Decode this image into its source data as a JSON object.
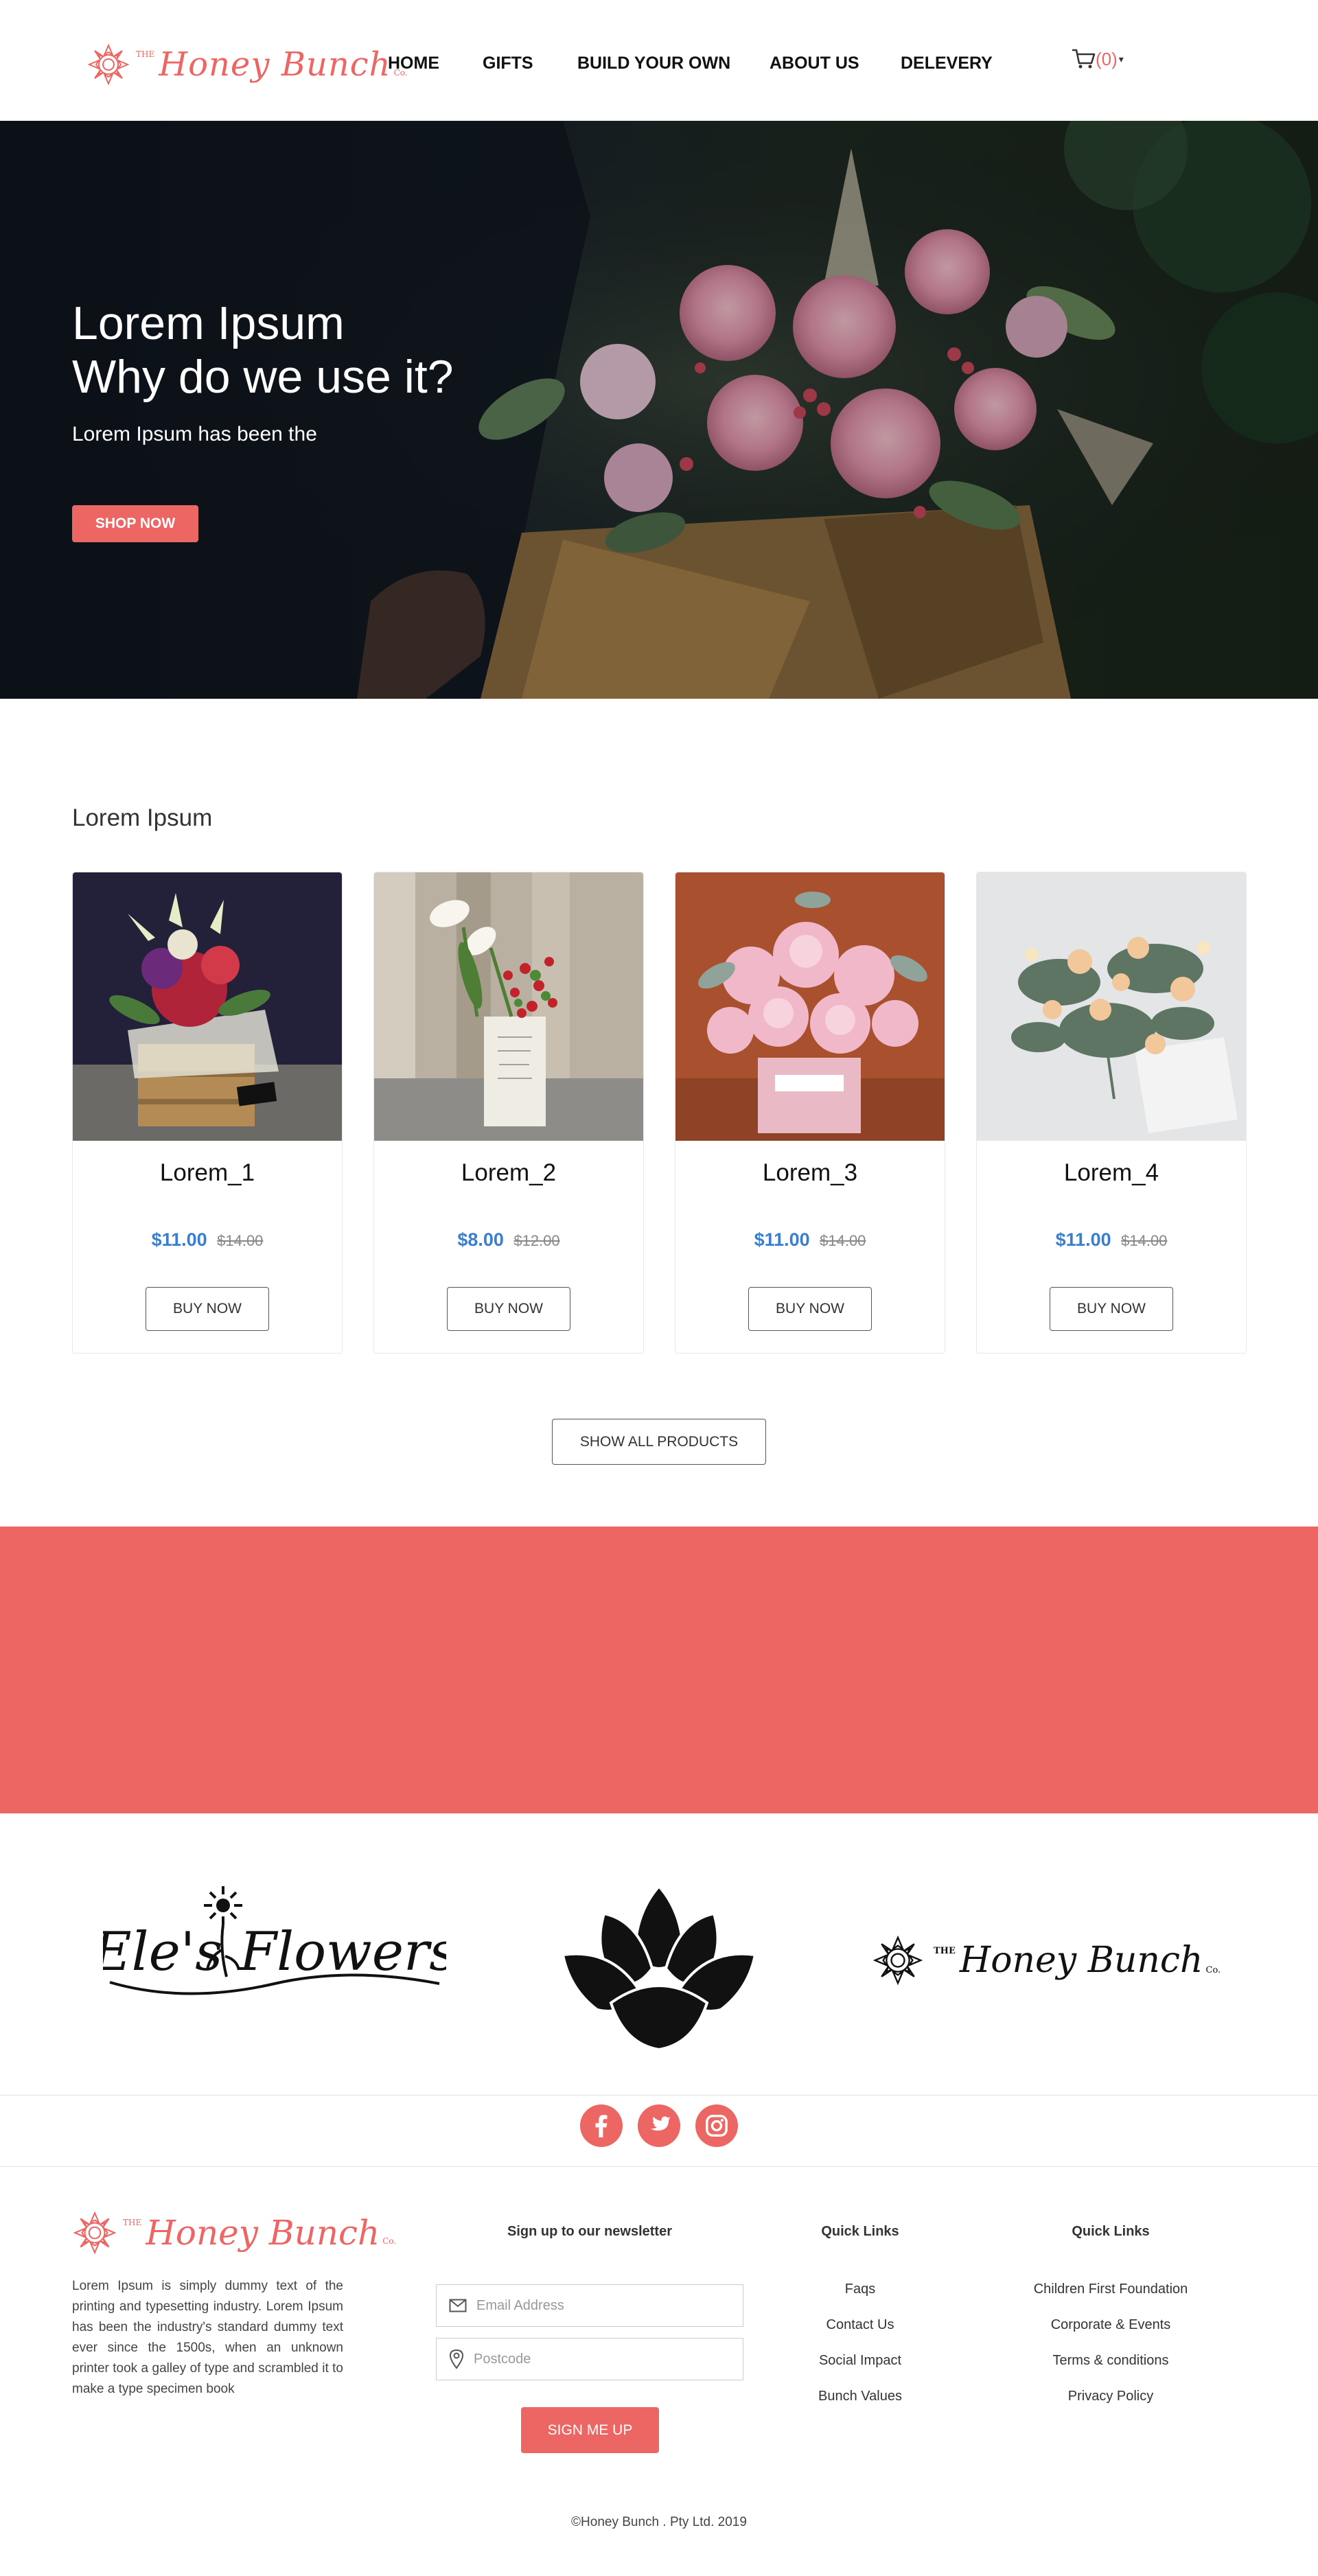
{
  "brand": {
    "logo_prefix": "THE",
    "logo_name": "Honey Bunch",
    "logo_suffix": "Co.",
    "accent_color": "#ec6664",
    "price_color": "#3a7fcf"
  },
  "nav": {
    "items": [
      "HOME",
      "GIFTS",
      "BUILD YOUR OWN",
      "ABOUT US",
      "DELEVERY"
    ]
  },
  "cart": {
    "icon": "cart-icon",
    "count_label": "(0)"
  },
  "hero": {
    "title_line1": "Lorem Ipsum",
    "title_line2": "Why do we use it?",
    "subtitle": "Lorem Ipsum has been the",
    "button_label": "SHOP NOW"
  },
  "products": {
    "section_title": "Lorem Ipsum",
    "items": [
      {
        "name": "Lorem_1",
        "price": "$11.00",
        "old_price": "$14.00",
        "button": "BUY NOW"
      },
      {
        "name": "Lorem_2",
        "price": "$8.00",
        "old_price": "$12.00",
        "button": "BUY NOW"
      },
      {
        "name": "Lorem_3",
        "price": "$11.00",
        "old_price": "$14.00",
        "button": "BUY NOW"
      },
      {
        "name": "Lorem_4",
        "price": "$11.00",
        "old_price": "$14.00",
        "button": "BUY NOW"
      }
    ],
    "show_all_label": "SHOW ALL PRODUCTS"
  },
  "partners": {
    "eles_flowers": "Ele's Flowers",
    "honey_bunch_prefix": "THE",
    "honey_bunch_name": "Honey Bunch",
    "honey_bunch_suffix": "Co."
  },
  "social": [
    "facebook-icon",
    "twitter-icon",
    "instagram-icon"
  ],
  "footer": {
    "about": "Lorem Ipsum is simply dummy text of the printing and typesetting industry. Lorem Ipsum has been the industry's standard dummy text ever since the 1500s, when an unknown printer took a galley of type and scrambled it to make a type specimen book",
    "newsletter_heading": "Sign up to our newsletter",
    "email_placeholder": "Email Address",
    "postcode_placeholder": "Postcode",
    "signup_label": "SIGN ME UP",
    "quick_links_1": {
      "heading": "Quick Links",
      "links": [
        "Faqs",
        "Contact Us",
        "Social Impact",
        "Bunch Values"
      ]
    },
    "quick_links_2": {
      "heading": "Quick Links",
      "links": [
        "Children First Foundation",
        "Corporate & Events",
        "Terms & conditions",
        "Privacy Policy"
      ]
    },
    "copyright": "©Honey Bunch . Pty Ltd. 2019"
  }
}
